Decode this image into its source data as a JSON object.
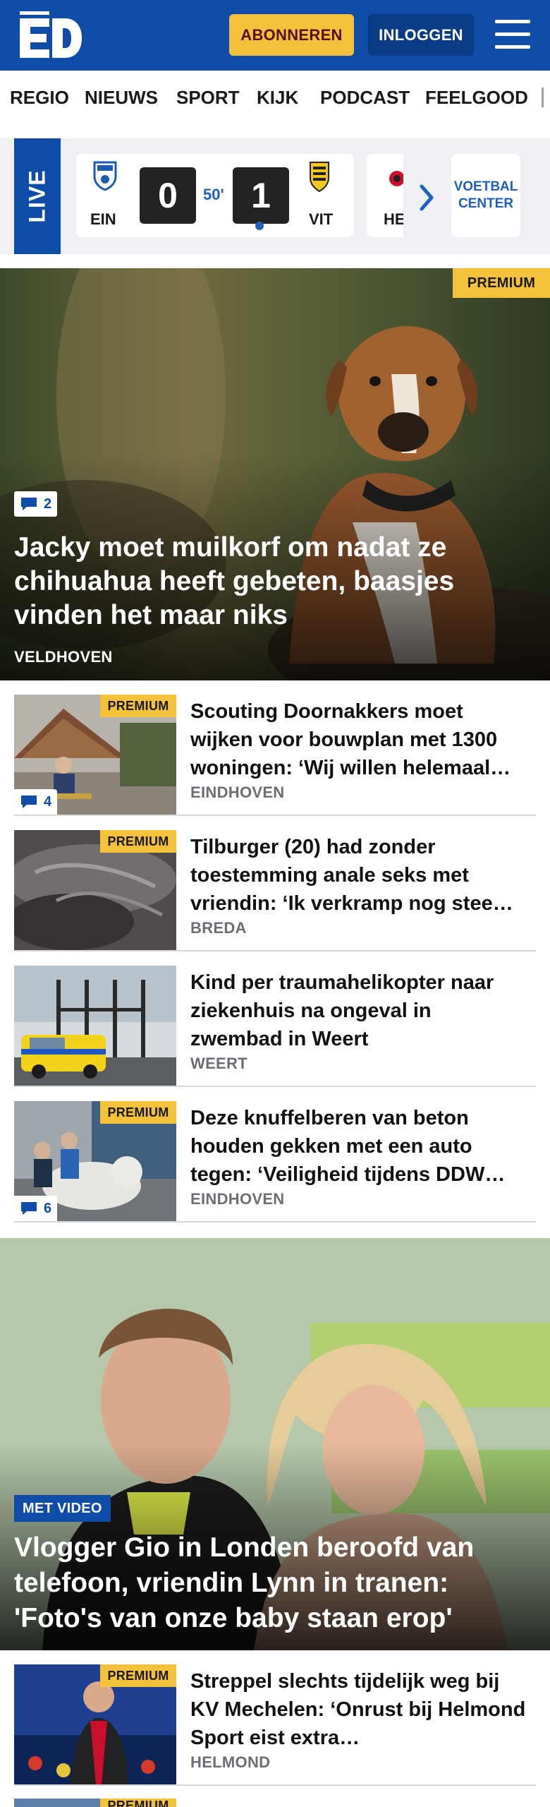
{
  "header": {
    "logo_text": "ED",
    "subscribe_label": "ABONNEREN",
    "login_label": "INLOGGEN",
    "colors": {
      "brand": "#0f4ca8",
      "accent": "#f3c23a"
    }
  },
  "nav": {
    "items": [
      {
        "label": "REGIO"
      },
      {
        "label": "NIEUWS"
      },
      {
        "label": "SPORT"
      },
      {
        "label": "KIJK"
      },
      {
        "label": "PODCAST"
      },
      {
        "label": "FEELGOOD"
      }
    ]
  },
  "live": {
    "label": "LIVE",
    "match": {
      "home_code": "EIN",
      "away_code": "VIT",
      "home_score": "0",
      "away_score": "1",
      "minute": "50'"
    },
    "next_match_code": "HE",
    "center_label_1": "VOETBAL",
    "center_label_2": "CENTER"
  },
  "hero": {
    "premium_label": "PREMIUM",
    "comments": "2",
    "title": "Jacky moet muilkorf om nadat ze chihuahua heeft gebeten, baasjes vinden het maar niks",
    "location": "VELDHOVEN"
  },
  "articles": [
    {
      "premium_label": "PREMIUM",
      "comments": "4",
      "title": "Scouting Doornakkers moet wijken voor bouwplan met 1300 woningen: ‘Wij willen helemaal…",
      "location": "EINDHOVEN"
    },
    {
      "premium_label": "PREMIUM",
      "comments": "",
      "title": "Tilburger (20) had zonder toestemming anale seks met vriendin: ‘Ik verkramp nog stee…",
      "location": "BREDA"
    },
    {
      "premium_label": "",
      "comments": "",
      "title": "Kind per traumahelikopter naar ziekenhuis na ongeval in zwembad in Weert",
      "location": "WEERT"
    },
    {
      "premium_label": "PREMIUM",
      "comments": "6",
      "title": "Deze knuffelberen van beton houden gekken met een auto tegen: ‘Veiligheid tijdens DDW…",
      "location": "EINDHOVEN"
    }
  ],
  "hero2": {
    "video_label": "MET VIDEO",
    "title": "Vlogger Gio in Londen beroofd van telefoon, vriendin Lynn in tranen: 'Foto's van onze baby staan erop'"
  },
  "articles2": [
    {
      "premium_label": "PREMIUM",
      "title": "Streppel slechts tijdelijk weg bij KV Mechelen: ‘Onrust bij Helmond Sport eist extra…",
      "location": "HELMOND"
    },
    {
      "premium_label": "PREMIUM"
    }
  ]
}
